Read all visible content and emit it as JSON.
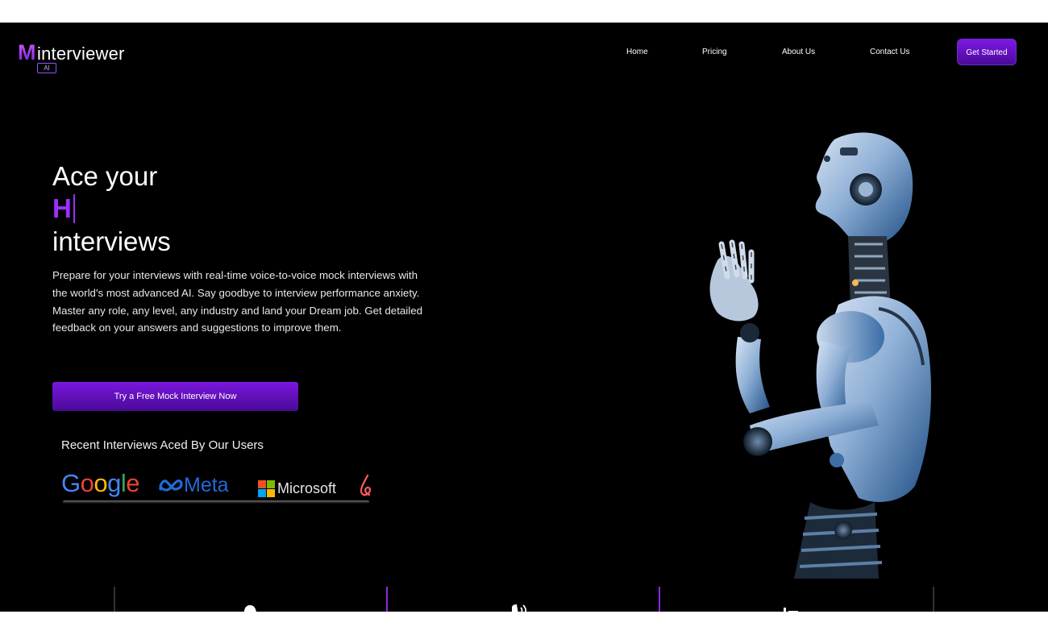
{
  "brand": {
    "logo_letter": "M",
    "logo_word": "interviewer",
    "logo_badge": "AI"
  },
  "nav": {
    "items": [
      {
        "label": "Home"
      },
      {
        "label": "Pricing"
      },
      {
        "label": "About Us"
      },
      {
        "label": "Contact Us"
      }
    ],
    "cta_label": "Get Started"
  },
  "hero": {
    "line1": "Ace your",
    "typed": "H",
    "line3": "interviews",
    "description": "Prepare for your interviews with real-time voice-to-voice mock interviews with the world's most advanced AI. Say goodbye to interview performance anxiety. Master any role, any level, any industry and land your Dream job. Get detailed feedback on your answers and suggestions to improve them.",
    "cta_label": "Try a Free Mock Interview Now"
  },
  "recent": {
    "title": "Recent Interviews Aced By Our Users",
    "logos": [
      {
        "name": "Google"
      },
      {
        "name": "Meta"
      },
      {
        "name": "Microsoft"
      }
    ]
  },
  "colors": {
    "accent": "#9b30ff",
    "button_top": "#7a16de",
    "button_bottom": "#4a0a96",
    "background": "#000000"
  },
  "icons": [
    "brain-icon",
    "voice-icon",
    "list-icon"
  ]
}
